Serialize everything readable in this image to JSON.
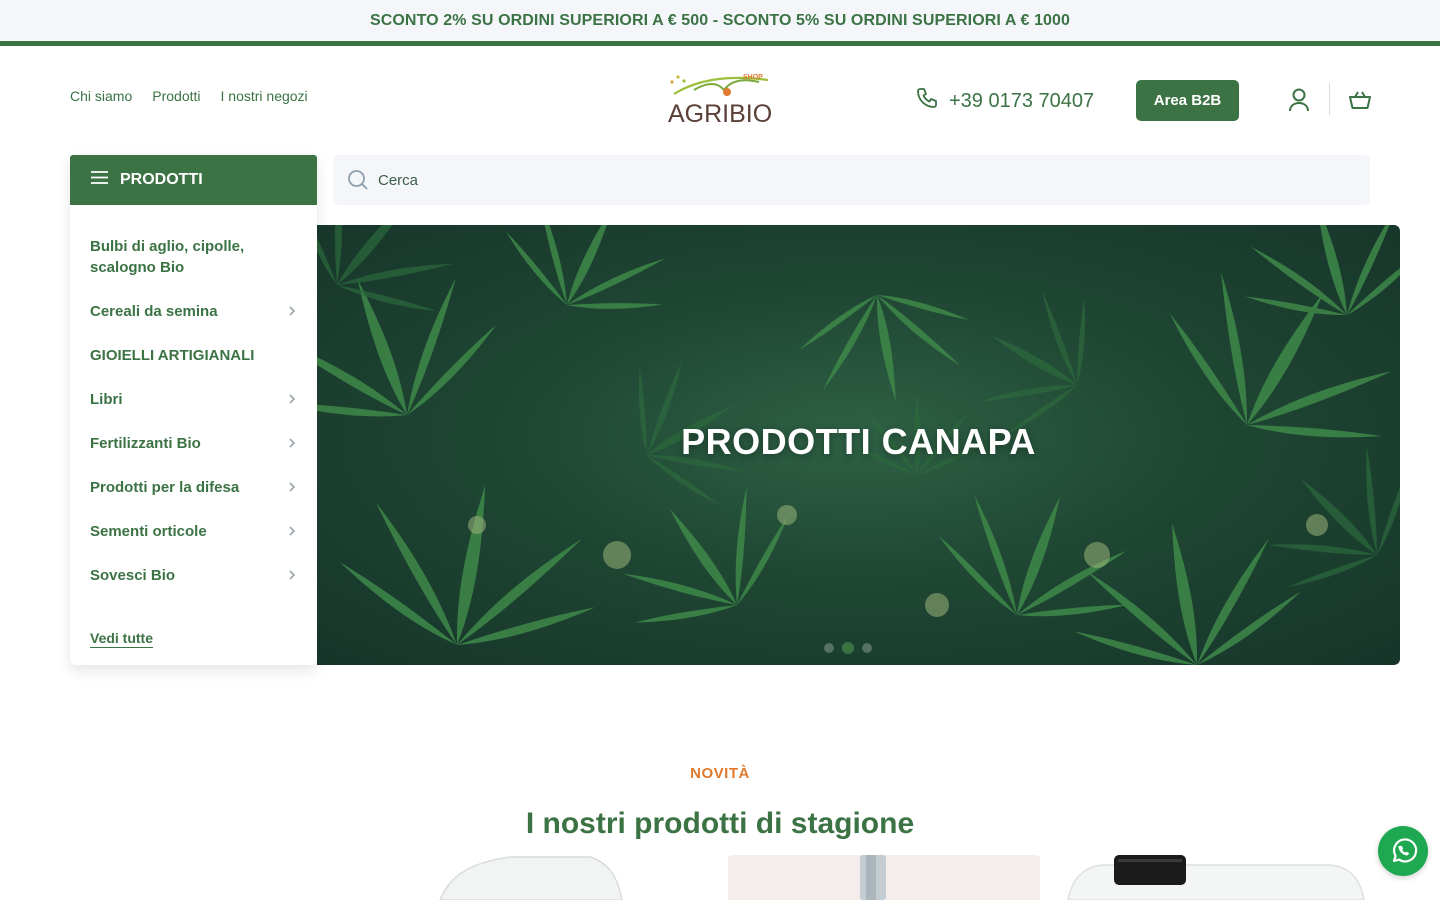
{
  "promo": {
    "text": "SCONTO 2% SU ORDINI SUPERIORI A € 500 - SCONTO 5% SU ORDINI SUPERIORI A € 1000"
  },
  "header": {
    "nav": [
      "Chi siamo",
      "Prodotti",
      "I nostri negozi"
    ],
    "logo_text": "AGRIBIO",
    "logo_badge": "SHOP",
    "phone": "+39 0173 70407",
    "b2b_label": "Area B2B"
  },
  "menu": {
    "title": "PRODOTTI",
    "items": [
      {
        "label": "Bulbi di aglio, cipolle, scalogno Bio",
        "has_children": false
      },
      {
        "label": "Cereali da semina",
        "has_children": true
      },
      {
        "label": "GIOIELLI ARTIGIANALI",
        "has_children": false
      },
      {
        "label": "Libri",
        "has_children": true
      },
      {
        "label": "Fertilizzanti Bio",
        "has_children": true
      },
      {
        "label": "Prodotti per la difesa",
        "has_children": true
      },
      {
        "label": "Sementi orticole",
        "has_children": true
      },
      {
        "label": "Sovesci Bio",
        "has_children": true
      }
    ],
    "see_all": "Vedi tutte"
  },
  "search": {
    "placeholder": "Cerca"
  },
  "hero": {
    "title": "PRODOTTI CANAPA",
    "slide_count": 3,
    "active_slide": 2
  },
  "section": {
    "eyebrow": "NOVITÀ",
    "title": "I nostri prodotti di stagione"
  },
  "colors": {
    "brand_green": "#3c7345",
    "accent_orange": "#e07a2e",
    "whatsapp_green": "#1fa852",
    "promo_bg": "#f4f6fa"
  },
  "icons": {
    "menu": "hamburger-icon",
    "search": "search-icon",
    "phone": "phone-icon",
    "user": "user-icon",
    "cart": "basket-icon",
    "chevron": "chevron-right-icon",
    "whatsapp": "whatsapp-icon"
  }
}
